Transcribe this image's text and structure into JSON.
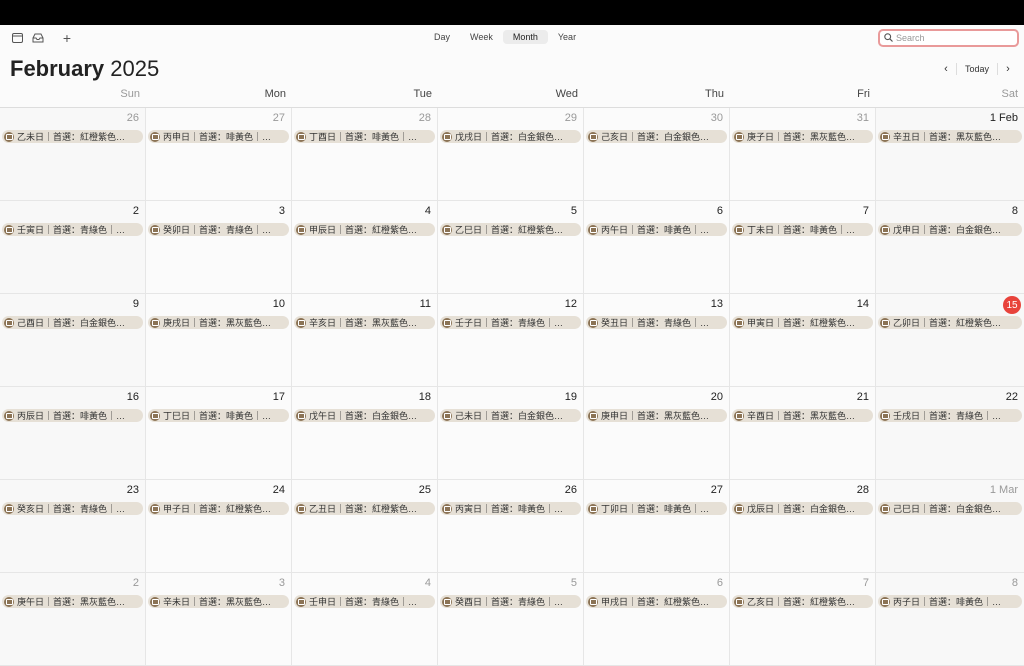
{
  "toolbar": {
    "views": [
      "Day",
      "Week",
      "Month",
      "Year"
    ],
    "active_view": "Month",
    "search_placeholder": "Search",
    "today_label": "Today"
  },
  "header": {
    "month": "February",
    "year": "2025"
  },
  "weekdays": [
    "Sun",
    "Mon",
    "Tue",
    "Wed",
    "Thu",
    "Fri",
    "Sat"
  ],
  "colors": {
    "today": "#e8433b",
    "event_bg": "#e6e0d6",
    "event_icon": "#8b7355"
  },
  "weeks": [
    [
      {
        "day": "26",
        "dim": true,
        "event": "乙未日｜首選：紅橙紫色…"
      },
      {
        "day": "27",
        "dim": true,
        "event": "丙申日｜首選：啡黃色｜…"
      },
      {
        "day": "28",
        "dim": true,
        "event": "丁酉日｜首選：啡黃色｜…"
      },
      {
        "day": "29",
        "dim": true,
        "event": "戊戌日｜首選：白金銀色…"
      },
      {
        "day": "30",
        "dim": true,
        "event": "己亥日｜首選：白金銀色…"
      },
      {
        "day": "31",
        "dim": true,
        "event": "庚子日｜首選：黑灰藍色…"
      },
      {
        "day": "1 Feb",
        "dim": false,
        "event": "辛丑日｜首選：黑灰藍色…"
      }
    ],
    [
      {
        "day": "2",
        "dim": false,
        "event": "壬寅日｜首選：青綠色｜…"
      },
      {
        "day": "3",
        "dim": false,
        "event": "癸卯日｜首選：青綠色｜…"
      },
      {
        "day": "4",
        "dim": false,
        "event": "甲辰日｜首選：紅橙紫色…"
      },
      {
        "day": "5",
        "dim": false,
        "event": "乙巳日｜首選：紅橙紫色…"
      },
      {
        "day": "6",
        "dim": false,
        "event": "丙午日｜首選：啡黃色｜…"
      },
      {
        "day": "7",
        "dim": false,
        "event": "丁未日｜首選：啡黃色｜…"
      },
      {
        "day": "8",
        "dim": false,
        "event": "戊申日｜首選：白金銀色…"
      }
    ],
    [
      {
        "day": "9",
        "dim": false,
        "event": "己酉日｜首選：白金銀色…"
      },
      {
        "day": "10",
        "dim": false,
        "event": "庚戌日｜首選：黑灰藍色…"
      },
      {
        "day": "11",
        "dim": false,
        "event": "辛亥日｜首選：黑灰藍色…"
      },
      {
        "day": "12",
        "dim": false,
        "event": "壬子日｜首選：青綠色｜…"
      },
      {
        "day": "13",
        "dim": false,
        "event": "癸丑日｜首選：青綠色｜…"
      },
      {
        "day": "14",
        "dim": false,
        "event": "甲寅日｜首選：紅橙紫色…"
      },
      {
        "day": "15",
        "dim": false,
        "today": true,
        "event": "乙卯日｜首選：紅橙紫色…"
      }
    ],
    [
      {
        "day": "16",
        "dim": false,
        "event": "丙辰日｜首選：啡黃色｜…"
      },
      {
        "day": "17",
        "dim": false,
        "event": "丁巳日｜首選：啡黃色｜…"
      },
      {
        "day": "18",
        "dim": false,
        "event": "戊午日｜首選：白金銀色…"
      },
      {
        "day": "19",
        "dim": false,
        "event": "己未日｜首選：白金銀色…"
      },
      {
        "day": "20",
        "dim": false,
        "event": "庚申日｜首選：黑灰藍色…"
      },
      {
        "day": "21",
        "dim": false,
        "event": "辛酉日｜首選：黑灰藍色…"
      },
      {
        "day": "22",
        "dim": false,
        "event": "壬戌日｜首選：青綠色｜…"
      }
    ],
    [
      {
        "day": "23",
        "dim": false,
        "event": "癸亥日｜首選：青綠色｜…"
      },
      {
        "day": "24",
        "dim": false,
        "event": "甲子日｜首選：紅橙紫色…"
      },
      {
        "day": "25",
        "dim": false,
        "event": "乙丑日｜首選：紅橙紫色…"
      },
      {
        "day": "26",
        "dim": false,
        "event": "丙寅日｜首選：啡黃色｜…"
      },
      {
        "day": "27",
        "dim": false,
        "event": "丁卯日｜首選：啡黃色｜…"
      },
      {
        "day": "28",
        "dim": false,
        "event": "戊辰日｜首選：白金銀色…"
      },
      {
        "day": "1 Mar",
        "dim": true,
        "event": "己巳日｜首選：白金銀色…"
      }
    ],
    [
      {
        "day": "2",
        "dim": true,
        "event": "庚午日｜首選：黑灰藍色…"
      },
      {
        "day": "3",
        "dim": true,
        "event": "辛未日｜首選：黑灰藍色…"
      },
      {
        "day": "4",
        "dim": true,
        "event": "壬申日｜首選：青綠色｜…"
      },
      {
        "day": "5",
        "dim": true,
        "event": "癸酉日｜首選：青綠色｜…"
      },
      {
        "day": "6",
        "dim": true,
        "event": "甲戌日｜首選：紅橙紫色…"
      },
      {
        "day": "7",
        "dim": true,
        "event": "乙亥日｜首選：紅橙紫色…"
      },
      {
        "day": "8",
        "dim": true,
        "event": "丙子日｜首選：啡黃色｜…"
      }
    ]
  ]
}
